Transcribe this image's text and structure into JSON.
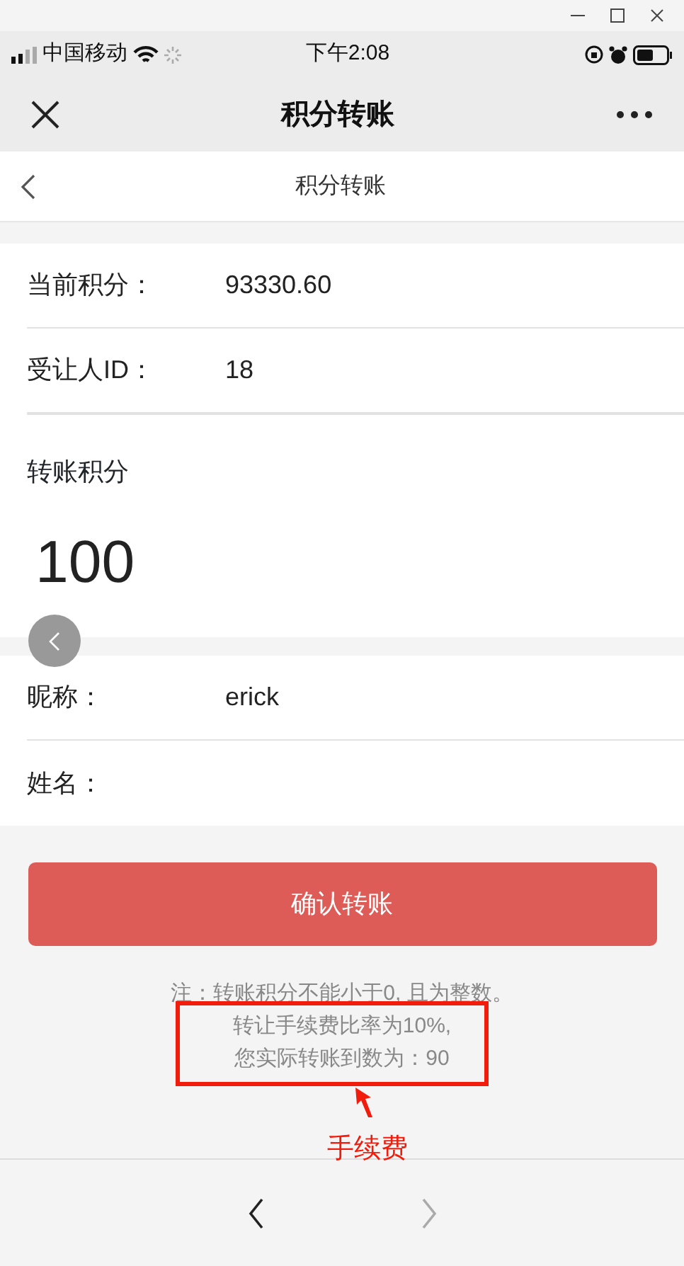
{
  "status_bar": {
    "carrier": "中国移动",
    "time": "下午2:08"
  },
  "nav_bar": {
    "title": "积分转账"
  },
  "page_header": {
    "title": "积分转账"
  },
  "info_rows": [
    {
      "label": "当前积分：",
      "value": "93330.60"
    },
    {
      "label": "受让人ID：",
      "value": "18"
    }
  ],
  "transfer": {
    "label": "转账积分",
    "value": "100"
  },
  "recipient_rows": [
    {
      "label": "昵称：",
      "value": "erick"
    },
    {
      "label": "姓名："
    }
  ],
  "confirm_button": "确认转账",
  "notes": [
    "注：转账积分不能小于0, 且为整数。",
    "转让手续费比率为10%,",
    "您实际转账到数为：90"
  ],
  "annotation": {
    "label": "手续费"
  },
  "bottom_nav": [
    {
      "kind": "back",
      "disabled": false
    },
    {
      "kind": "forward",
      "disabled": true
    }
  ]
}
